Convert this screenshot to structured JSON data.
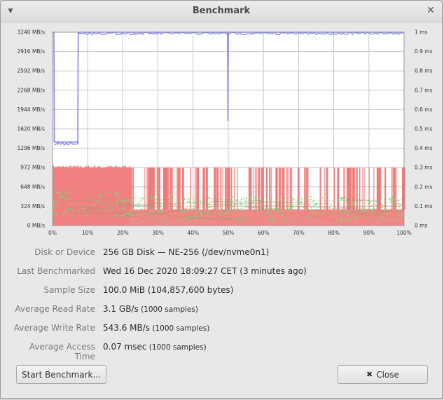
{
  "window": {
    "title": "Benchmark"
  },
  "chart_data": {
    "type": "line",
    "left_axis_ticks": [
      "0 MB/s",
      "324 MB/s",
      "648 MB/s",
      "972 MB/s",
      "1296 MB/s",
      "1620 MB/s",
      "1944 MB/s",
      "2268 MB/s",
      "2592 MB/s",
      "2916 MB/s",
      "3240 MB/s"
    ],
    "right_axis_ticks": [
      "0 ms",
      "0.1 ms",
      "0.2 ms",
      "0.3 ms",
      "0.4 ms",
      "0.5 ms",
      "0.6 ms",
      "0.7 ms",
      "0.8 ms",
      "0.9 ms",
      "1 ms"
    ],
    "x_ticks": [
      "0%",
      "10%",
      "20%",
      "30%",
      "40%",
      "50%",
      "60%",
      "70%",
      "80%",
      "90%",
      "100%"
    ],
    "ylim": [
      0,
      3240
    ],
    "y2lim": [
      0,
      1
    ],
    "xlim": [
      0,
      100
    ],
    "grid": true,
    "series_colors": {
      "read": "#7b7bef",
      "write": "#f07a7a",
      "access": "#6ee06e"
    },
    "read_segments": [
      {
        "x": [
          0,
          0.4,
          0.5,
          7,
          7.2,
          7.3,
          100
        ],
        "y": [
          3240,
          3240,
          1400,
          1400,
          1360,
          3240,
          3240
        ]
      },
      {
        "x": [
          49.8,
          49.9,
          50.0,
          50.2
        ],
        "y": [
          3240,
          1750,
          3240,
          3240
        ]
      }
    ],
    "write_level_mbps": 972,
    "write_dense_until_pct": 22,
    "write_low_level_mbps": 270,
    "access_band_ms": [
      0.02,
      0.15
    ]
  },
  "info": [
    {
      "label": "Disk or Device",
      "value": "256 GB Disk — NE-256 (/dev/nvme0n1)",
      "note": ""
    },
    {
      "label": "Last Benchmarked",
      "value": "Wed 16 Dec 2020 18:09:27 CET (3 minutes ago)",
      "note": ""
    },
    {
      "label": "Sample Size",
      "value": "100.0 MiB (104,857,600 bytes)",
      "note": ""
    },
    {
      "label": "Average Read Rate",
      "value": "3.1 GB/s",
      "note": "(1000 samples)"
    },
    {
      "label": "Average Write Rate",
      "value": "543.6 MB/s",
      "note": "(1000 samples)"
    },
    {
      "label": "Average Access Time",
      "value": "0.07 msec",
      "note": "(1000 samples)"
    }
  ],
  "buttons": {
    "start": "Start Benchmark...",
    "close": "Close"
  },
  "icons": {
    "menu": "chevron-down-icon",
    "window_close": "close-icon",
    "close_button": "x-icon"
  }
}
